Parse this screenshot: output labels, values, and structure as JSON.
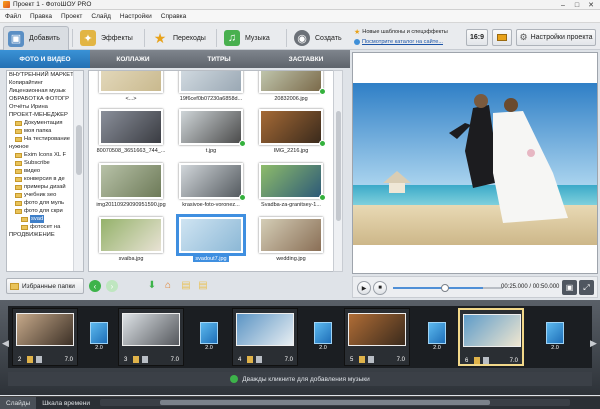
{
  "window": {
    "title": "Проект 1 - ФотоШОУ PRO",
    "controls": [
      "–",
      "□",
      "✕"
    ]
  },
  "menu": [
    "Файл",
    "Правка",
    "Проект",
    "Слайд",
    "Настройки",
    "Справка"
  ],
  "main_tabs": [
    {
      "label": "Добавить",
      "icon": "add-photo-icon"
    },
    {
      "label": "Эффекты",
      "icon": "effects-icon"
    },
    {
      "label": "Переходы",
      "icon": "transitions-star-icon"
    },
    {
      "label": "Музыка",
      "icon": "music-icon"
    },
    {
      "label": "Создать",
      "icon": "film-reel-icon"
    }
  ],
  "hints": {
    "templates": "Новые шаблоны и спецэффекты",
    "catalog_link": "Посмотрите каталог на сайте..."
  },
  "toolbar": {
    "aspect": "16:9",
    "settings": "Настройки проекта"
  },
  "sub_tabs": [
    "ФОТО И ВИДЕО",
    "КОЛЛАЖИ",
    "ТИТРЫ",
    "ЗАСТАВКИ"
  ],
  "tree": [
    {
      "label": "ВНУТРЕННИЙ МАРКЕТ",
      "indent": 0,
      "folder": false
    },
    {
      "label": "Копирайтинг",
      "indent": 0,
      "folder": false
    },
    {
      "label": "Лицензионная музык",
      "indent": 0,
      "folder": false
    },
    {
      "label": "ОБРАБОТКА ФОТОГР",
      "indent": 0,
      "folder": false
    },
    {
      "label": "Отчёты Ирина",
      "indent": 0,
      "folder": false
    },
    {
      "label": "ПРОЕКТ-МЕНЕДЖЕР",
      "indent": 0,
      "folder": false
    },
    {
      "label": "Документация",
      "indent": 1,
      "folder": true
    },
    {
      "label": "моя папка",
      "indent": 1,
      "folder": true
    },
    {
      "label": "На тестирование",
      "indent": 1,
      "folder": true
    },
    {
      "label": "нужное",
      "indent": 0,
      "folder": false
    },
    {
      "label": "Exim Icons XL F",
      "indent": 1,
      "folder": true
    },
    {
      "label": "Subscribe",
      "indent": 1,
      "folder": true
    },
    {
      "label": "видео",
      "indent": 1,
      "folder": true
    },
    {
      "label": "конверсия в де",
      "indent": 1,
      "folder": true
    },
    {
      "label": "примеры дизай",
      "indent": 1,
      "folder": true
    },
    {
      "label": "учебник seo",
      "indent": 1,
      "folder": true
    },
    {
      "label": "фото для муль",
      "indent": 1,
      "folder": true
    },
    {
      "label": "фото для скри",
      "indent": 1,
      "folder": true
    },
    {
      "label": "svad",
      "indent": 2,
      "folder": true,
      "selected": true
    },
    {
      "label": "фотосет на",
      "indent": 2,
      "folder": true
    },
    {
      "label": "ПРОДВИЖЕНИЕ",
      "indent": 0,
      "folder": false
    }
  ],
  "thumbnails": [
    {
      "caption": "<...>",
      "colors": [
        "#e6dcc0",
        "#c9b98e"
      ],
      "checked": false,
      "selected": false
    },
    {
      "caption": "19f6cef0b07230a6858d...",
      "colors": [
        "#d8e0e6",
        "#9aa8b4"
      ],
      "checked": false,
      "selected": false
    },
    {
      "caption": "20832006.jpg",
      "colors": [
        "#c9d2ba",
        "#7b6a4a"
      ],
      "checked": true,
      "selected": false
    },
    {
      "caption": "80070508_3651663_744_...",
      "colors": [
        "#8a8f9a",
        "#3a3c42"
      ],
      "checked": false,
      "selected": false
    },
    {
      "caption": "t.jpg",
      "colors": [
        "#cfd5d8",
        "#4b4b4b"
      ],
      "checked": true,
      "selected": false
    },
    {
      "caption": "IMG_2216.jpg",
      "colors": [
        "#a56a36",
        "#3a2a1c"
      ],
      "checked": true,
      "selected": false
    },
    {
      "caption": "img20110929090951590.jpg",
      "colors": [
        "#b8c2a8",
        "#6d7a58"
      ],
      "checked": false,
      "selected": false
    },
    {
      "caption": "krasivoe-foto-voronez...",
      "colors": [
        "#d1d6da",
        "#555b60"
      ],
      "checked": true,
      "selected": false
    },
    {
      "caption": "Svadba-za-granitsey-1...",
      "colors": [
        "#8ebc6a",
        "#2d5a78"
      ],
      "checked": true,
      "selected": false
    },
    {
      "caption": "svaiba.jpg",
      "colors": [
        "#94b26a",
        "#e8e2d4"
      ],
      "checked": false,
      "selected": false
    },
    {
      "caption": "svadout7.jpg",
      "colors": [
        "#cfe4f2",
        "#8cb8d6"
      ],
      "checked": false,
      "selected": true
    },
    {
      "caption": "wedding.jpg",
      "colors": [
        "#d4cdb6",
        "#8a6f56"
      ],
      "checked": false,
      "selected": false
    }
  ],
  "favorites_label": "Избранные папки",
  "player": {
    "time": "00:25.000 / 00:50.000",
    "progress": 0.5
  },
  "slides": [
    {
      "num": "2",
      "duration": "7.0",
      "colors": [
        "#c6a98a",
        "#3c3026"
      ],
      "selected": false
    },
    {
      "num": "3",
      "duration": "7.0",
      "colors": [
        "#dde2e6",
        "#55585d"
      ],
      "selected": false
    },
    {
      "num": "4",
      "duration": "7.0",
      "colors": [
        "#5b94c4",
        "#e8eef2"
      ],
      "selected": false
    },
    {
      "num": "5",
      "duration": "7.0",
      "colors": [
        "#b06d36",
        "#3a2a1c"
      ],
      "selected": false
    },
    {
      "num": "6",
      "duration": "7.0",
      "colors": [
        "#5d9bc9",
        "#efe6d0"
      ],
      "selected": true
    }
  ],
  "transitions": [
    "2.0",
    "2.0",
    "2.0",
    "2.0",
    "2.0"
  ],
  "music_hint": "Дважды кликните для добавления музыки",
  "bottom_tabs": [
    "Слайды",
    "Шкала времени"
  ]
}
